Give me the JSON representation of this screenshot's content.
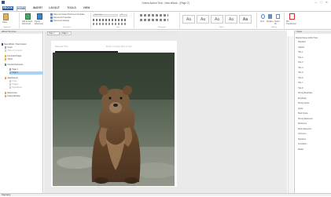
{
  "window": {
    "title": "Ovens Author Trial - New eBook - [Page 2]",
    "min": "—",
    "max": "□",
    "close": "✕"
  },
  "menu": {
    "file": "EBOOK",
    "home": "HOME",
    "insert": "INSERT",
    "layout": "LAYOUT",
    "tools": "TOOLS",
    "view": "VIEW"
  },
  "ribbon": {
    "paste": "Paste",
    "clipboard": "Clipboard",
    "add_content": "Add Content Document",
    "import": "Import Document",
    "doc_items": [
      "Save as Content Document Template",
      "Document Properties",
      "Document Settings"
    ],
    "document": "Document",
    "font": "Font",
    "paragraph": "Paragraph",
    "styles": "Styles",
    "editing": "Editing",
    "find": "Find",
    "replace": "Replace",
    "select": "Select All",
    "convert": "MS Transformer",
    "font_value": "Open Sans",
    "size_value": "11",
    "style_swatches": [
      "Aa",
      "Aa",
      "Aa",
      "Aa",
      "Aa"
    ]
  },
  "left_panel": {
    "title": "eBook Structure",
    "items": [
      "New eBook - Fixed Layout",
      "Cover",
      "Table of Contents",
      "Front End Pages",
      "Topics",
      "Content Document",
      "Page 1",
      "Page 2",
      "Attachments",
      "Fonts",
      "Images",
      "Stylesheets",
      "References",
      "Popup Window"
    ]
  },
  "tabs": {
    "active": "Page 2",
    "other": "Page 1"
  },
  "page": {
    "title_placeholder": "Sample Title",
    "text_placeholder": "Enter a single line of text"
  },
  "right_panel": {
    "title": "Styles",
    "header": "Display Name Author Note",
    "items": [
      "Standard",
      "Caption",
      "Title 1",
      "Title 2",
      "Title 3",
      "Title 4",
      "Title 5",
      "Title 6",
      "Title 7",
      "Title 8",
      "Strong Emphasis",
      "Emphasis",
      "Strong Quote",
      "Quote",
      "Book Quote",
      "Strong Reference",
      "Reference",
      "Book Reference",
      "Comment",
      "Signature",
      "Annotation",
      "Marker"
    ]
  },
  "status": {
    "text": "Paginating"
  }
}
